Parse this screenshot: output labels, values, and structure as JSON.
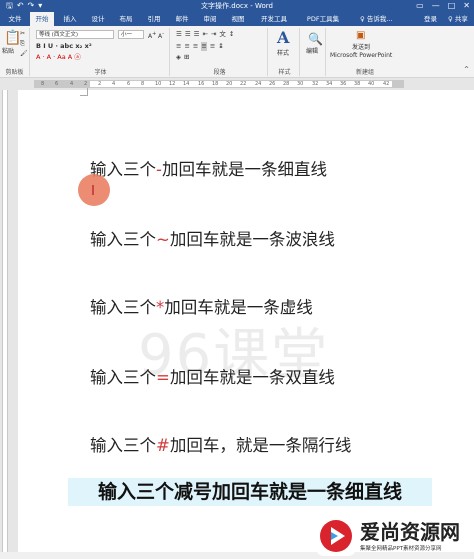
{
  "window": {
    "title": "文字操作.docx - Word",
    "controls": [
      "—",
      "□",
      "✕"
    ]
  },
  "tabs": [
    "文件",
    "开始",
    "插入",
    "设计",
    "布局",
    "引用",
    "邮件",
    "审阅",
    "视图",
    "开发工具",
    "PDF工具集"
  ],
  "active_tab": "开始",
  "tell_me": "♀ 告诉我...",
  "login": "登录",
  "share": "♀ 共享",
  "ribbon": {
    "clipboard": {
      "paste": "粘贴",
      "label": "剪贴板"
    },
    "font": {
      "font_name": "等线 (西文正文)",
      "font_size": "小一",
      "label": "字体",
      "row2": "B  I  U  ·  abc  x₂  x²",
      "row3": "A  ·  A  ·  Aa  A  ⓐ"
    },
    "paragraph": {
      "label": "段落"
    },
    "styles": {
      "style_glyph": "A",
      "style_label": "样式",
      "label": "样式"
    },
    "editing": {
      "label": "编辑"
    },
    "new_group": {
      "send_line1": "发送到",
      "send_line2": "Microsoft PowerPoint",
      "label": "新建组"
    }
  },
  "ruler_numbers": [
    "8",
    "6",
    "4",
    "2",
    "2",
    "4",
    "6",
    "8",
    "10",
    "12",
    "14",
    "16",
    "18",
    "20",
    "22",
    "24",
    "26",
    "28",
    "30",
    "32",
    "34",
    "36",
    "38",
    "40",
    "42"
  ],
  "document": {
    "lines": [
      {
        "before": "输入三个",
        "sym": "-",
        "after": "加回车就是一条细直线"
      },
      {
        "before": "输入三个",
        "sym": "~",
        "after": "加回车就是一条波浪线"
      },
      {
        "before": "输入三个",
        "sym": "*",
        "after": "加回车就是一条虚线"
      },
      {
        "before": "输入三个",
        "sym": "=",
        "after": "加回车就是一条双直线"
      },
      {
        "before": "输入三个",
        "sym": "#",
        "after": "加回车，就是一条隔行线"
      }
    ],
    "watermark": "96课堂"
  },
  "subtitle": "输入三个减号加回车就是一条细直线",
  "logo": {
    "name": "爱尚资源网",
    "slogan": "集聚全网精品PPT素材资源分享网"
  },
  "colors": {
    "word_blue": "#2b579a",
    "symbol_red": "#d23c3c",
    "subtitle_bg": "#e0f4fb",
    "logo_red": "#d9232d"
  }
}
